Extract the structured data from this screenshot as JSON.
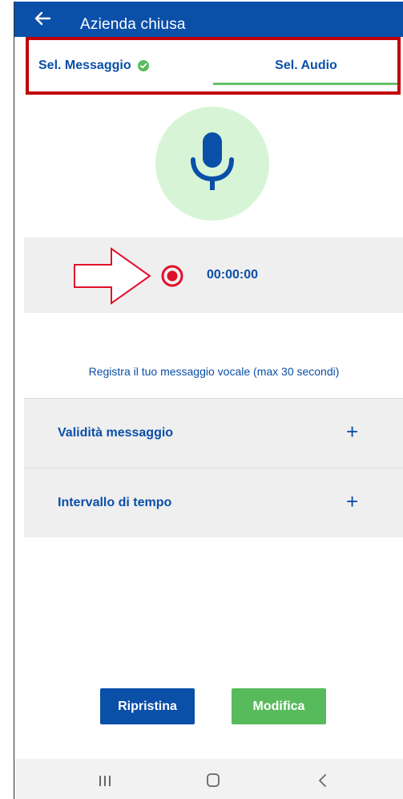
{
  "appbar": {
    "title": "Azienda chiusa",
    "back_icon": "arrow-left-icon"
  },
  "tabs": [
    {
      "label": "Sel. Messaggio",
      "completed": true,
      "selected": false,
      "icon": "check-circle-icon"
    },
    {
      "label": "Sel. Audio",
      "selected": true
    }
  ],
  "recorder": {
    "mic_icon": "microphone-icon",
    "record_icon": "record-icon",
    "timer": "00:00:00",
    "hint": "Registra il tuo messaggio vocale (max 30 secondi)"
  },
  "accordions": [
    {
      "label": "Validità messaggio",
      "expand_glyph": "+"
    },
    {
      "label": "Intervallo di tempo",
      "expand_glyph": "+"
    }
  ],
  "actions": {
    "reset_label": "Ripristina",
    "edit_label": "Modifica"
  },
  "colors": {
    "primary": "#0a4fa8",
    "accent_green": "#58bb5b",
    "mic_bg": "#d7f5d6",
    "record_red": "#e0102a",
    "annotation_red": "#c00000"
  },
  "system_nav": [
    "recent-apps-icon",
    "home-icon",
    "back-chevron-icon"
  ]
}
